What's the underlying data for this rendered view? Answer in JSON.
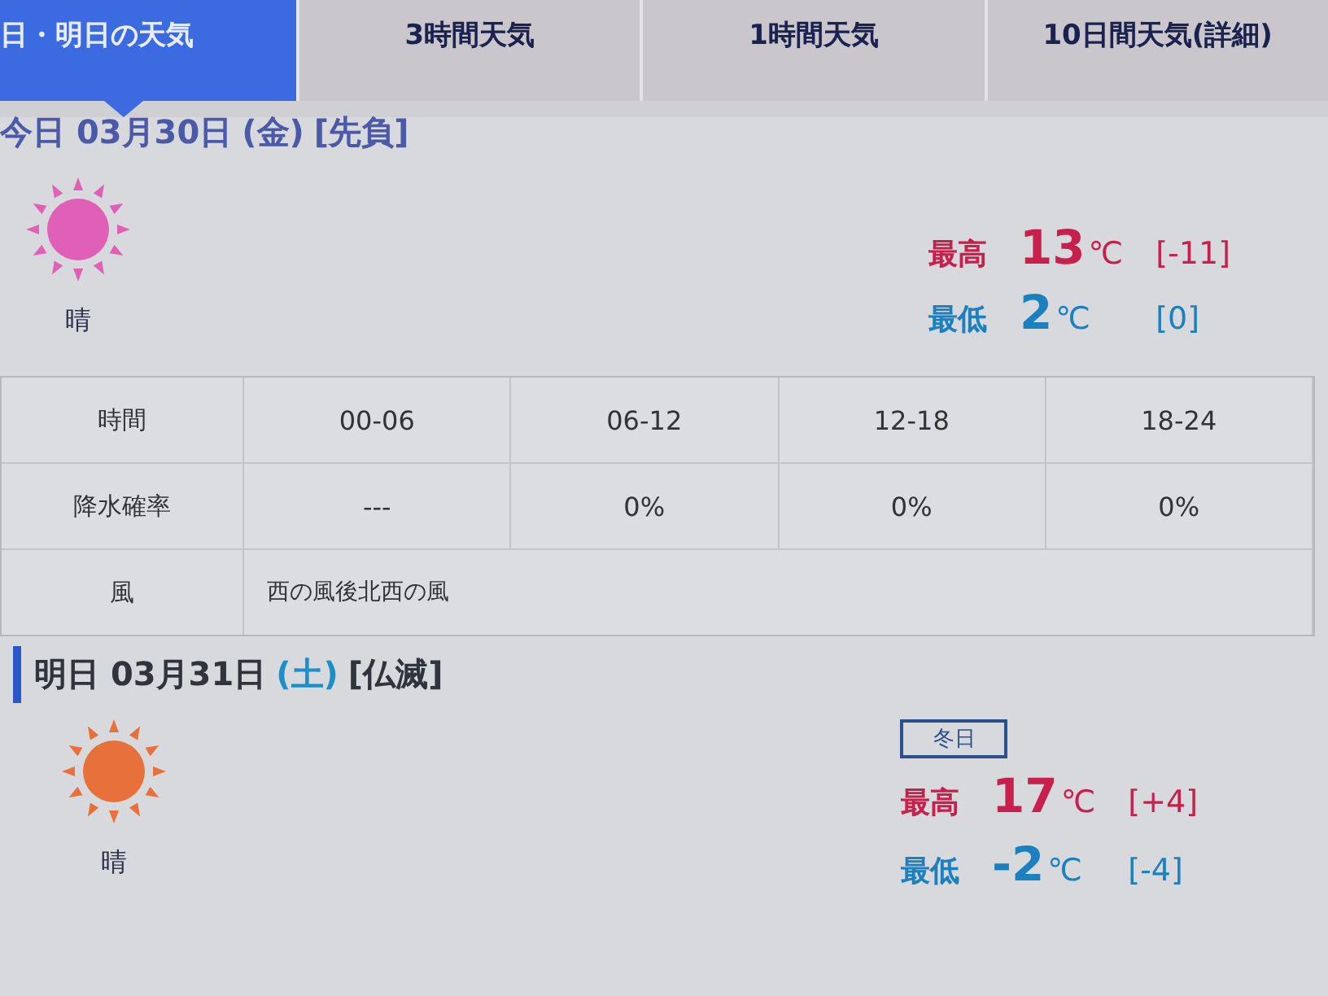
{
  "tabs": [
    {
      "label": "日・明日の天気",
      "selected": true
    },
    {
      "label": "3時間天気",
      "selected": false
    },
    {
      "label": "1時間天気",
      "selected": false
    },
    {
      "label": "10日間天気(詳細)",
      "selected": false
    }
  ],
  "days": [
    {
      "date": "今日 03月30日",
      "weekday": {
        "text": "(金)",
        "color": "#4a5aa8"
      },
      "rokuyo": "[先負]",
      "weather": {
        "label": "晴",
        "color": "#e060b8"
      },
      "high": {
        "label": "最高",
        "value": "13",
        "unit": "℃",
        "diff": "[-11]"
      },
      "low": {
        "label": "最低",
        "value": "2",
        "unit": "℃",
        "diff": "[0]"
      },
      "table": [
        {
          "label": "時間",
          "cells": [
            "00-06",
            "06-12",
            "12-18",
            "18-24"
          ]
        },
        {
          "label": "降水確率",
          "cells": [
            "---",
            "0%",
            "0%",
            "0%"
          ]
        },
        {
          "label": "風",
          "cells": [
            "西の風後北西の風"
          ]
        }
      ]
    },
    {
      "date": "明日 03月31日",
      "weekday": {
        "text": "(土)",
        "color": "#1a8fc8"
      },
      "rokuyo": "[仏滅]",
      "weather": {
        "label": "晴",
        "color": "#e8703a"
      },
      "badge": "冬日",
      "high": {
        "label": "最高",
        "value": "17",
        "unit": "℃",
        "diff": "[+4]"
      },
      "low": {
        "label": "最低",
        "value": "-2",
        "unit": "℃",
        "diff": "[-4]"
      }
    }
  ]
}
